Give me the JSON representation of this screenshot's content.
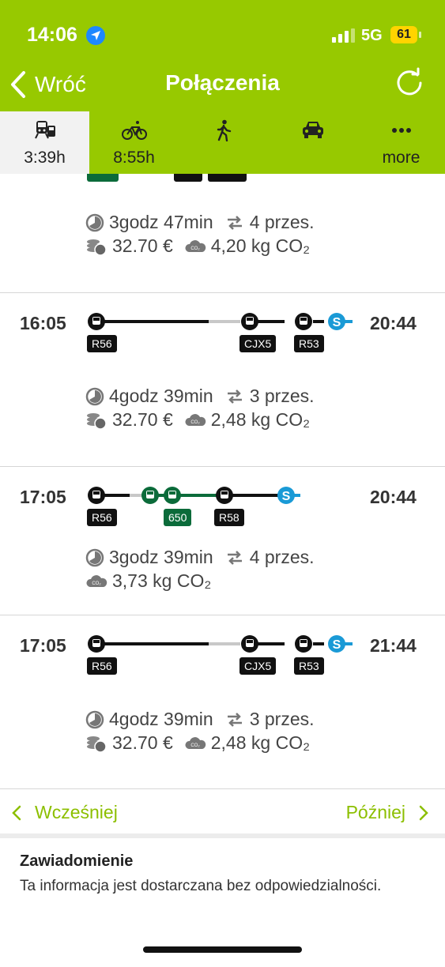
{
  "status_bar": {
    "time": "14:06",
    "network": "5G",
    "battery": "61"
  },
  "nav": {
    "back_label": "Wróć",
    "title": "Połączenia"
  },
  "tabs": [
    {
      "icon": "train-bus-icon",
      "label": "3:39h"
    },
    {
      "icon": "bicycle-icon",
      "label": "8:55h"
    },
    {
      "icon": "walking-icon",
      "label": ""
    },
    {
      "icon": "car-icon",
      "label": ""
    },
    {
      "icon": "more-icon",
      "label": "more"
    }
  ],
  "connections": [
    {
      "departure": "",
      "arrival": "",
      "duration": "3godz 47min",
      "transfers": "4 przes.",
      "price": "32.70  €",
      "co2": "4,20 kg CO₂"
    },
    {
      "departure": "16:05",
      "arrival": "20:44",
      "lines": [
        "R56",
        "CJX5",
        "R53"
      ],
      "duration": "4godz 39min",
      "transfers": "3 przes.",
      "price": "32.70  €",
      "co2": "2,48 kg CO₂"
    },
    {
      "departure": "17:05",
      "arrival": "20:44",
      "lines": [
        "R56",
        "650",
        "R58"
      ],
      "duration": "3godz 39min",
      "transfers": "4 przes.",
      "co2": "3,73 kg CO₂"
    },
    {
      "departure": "17:05",
      "arrival": "21:44",
      "lines": [
        "R56",
        "CJX5",
        "R53"
      ],
      "duration": "4godz 39min",
      "transfers": "3 przes.",
      "price": "32.70  €",
      "co2": "2,48 kg CO₂"
    }
  ],
  "pager": {
    "earlier": "Wcześniej",
    "later": "Później"
  },
  "notice": {
    "heading": "Zawiadomienie",
    "text": "Ta informacja jest dostarczana bez odpowiedzialności."
  },
  "colors": {
    "brand_green": "#97c900",
    "link_green": "#8cbf00",
    "bus_green": "#0b6b3a",
    "s_bahn_blue": "#1a9ad6"
  }
}
